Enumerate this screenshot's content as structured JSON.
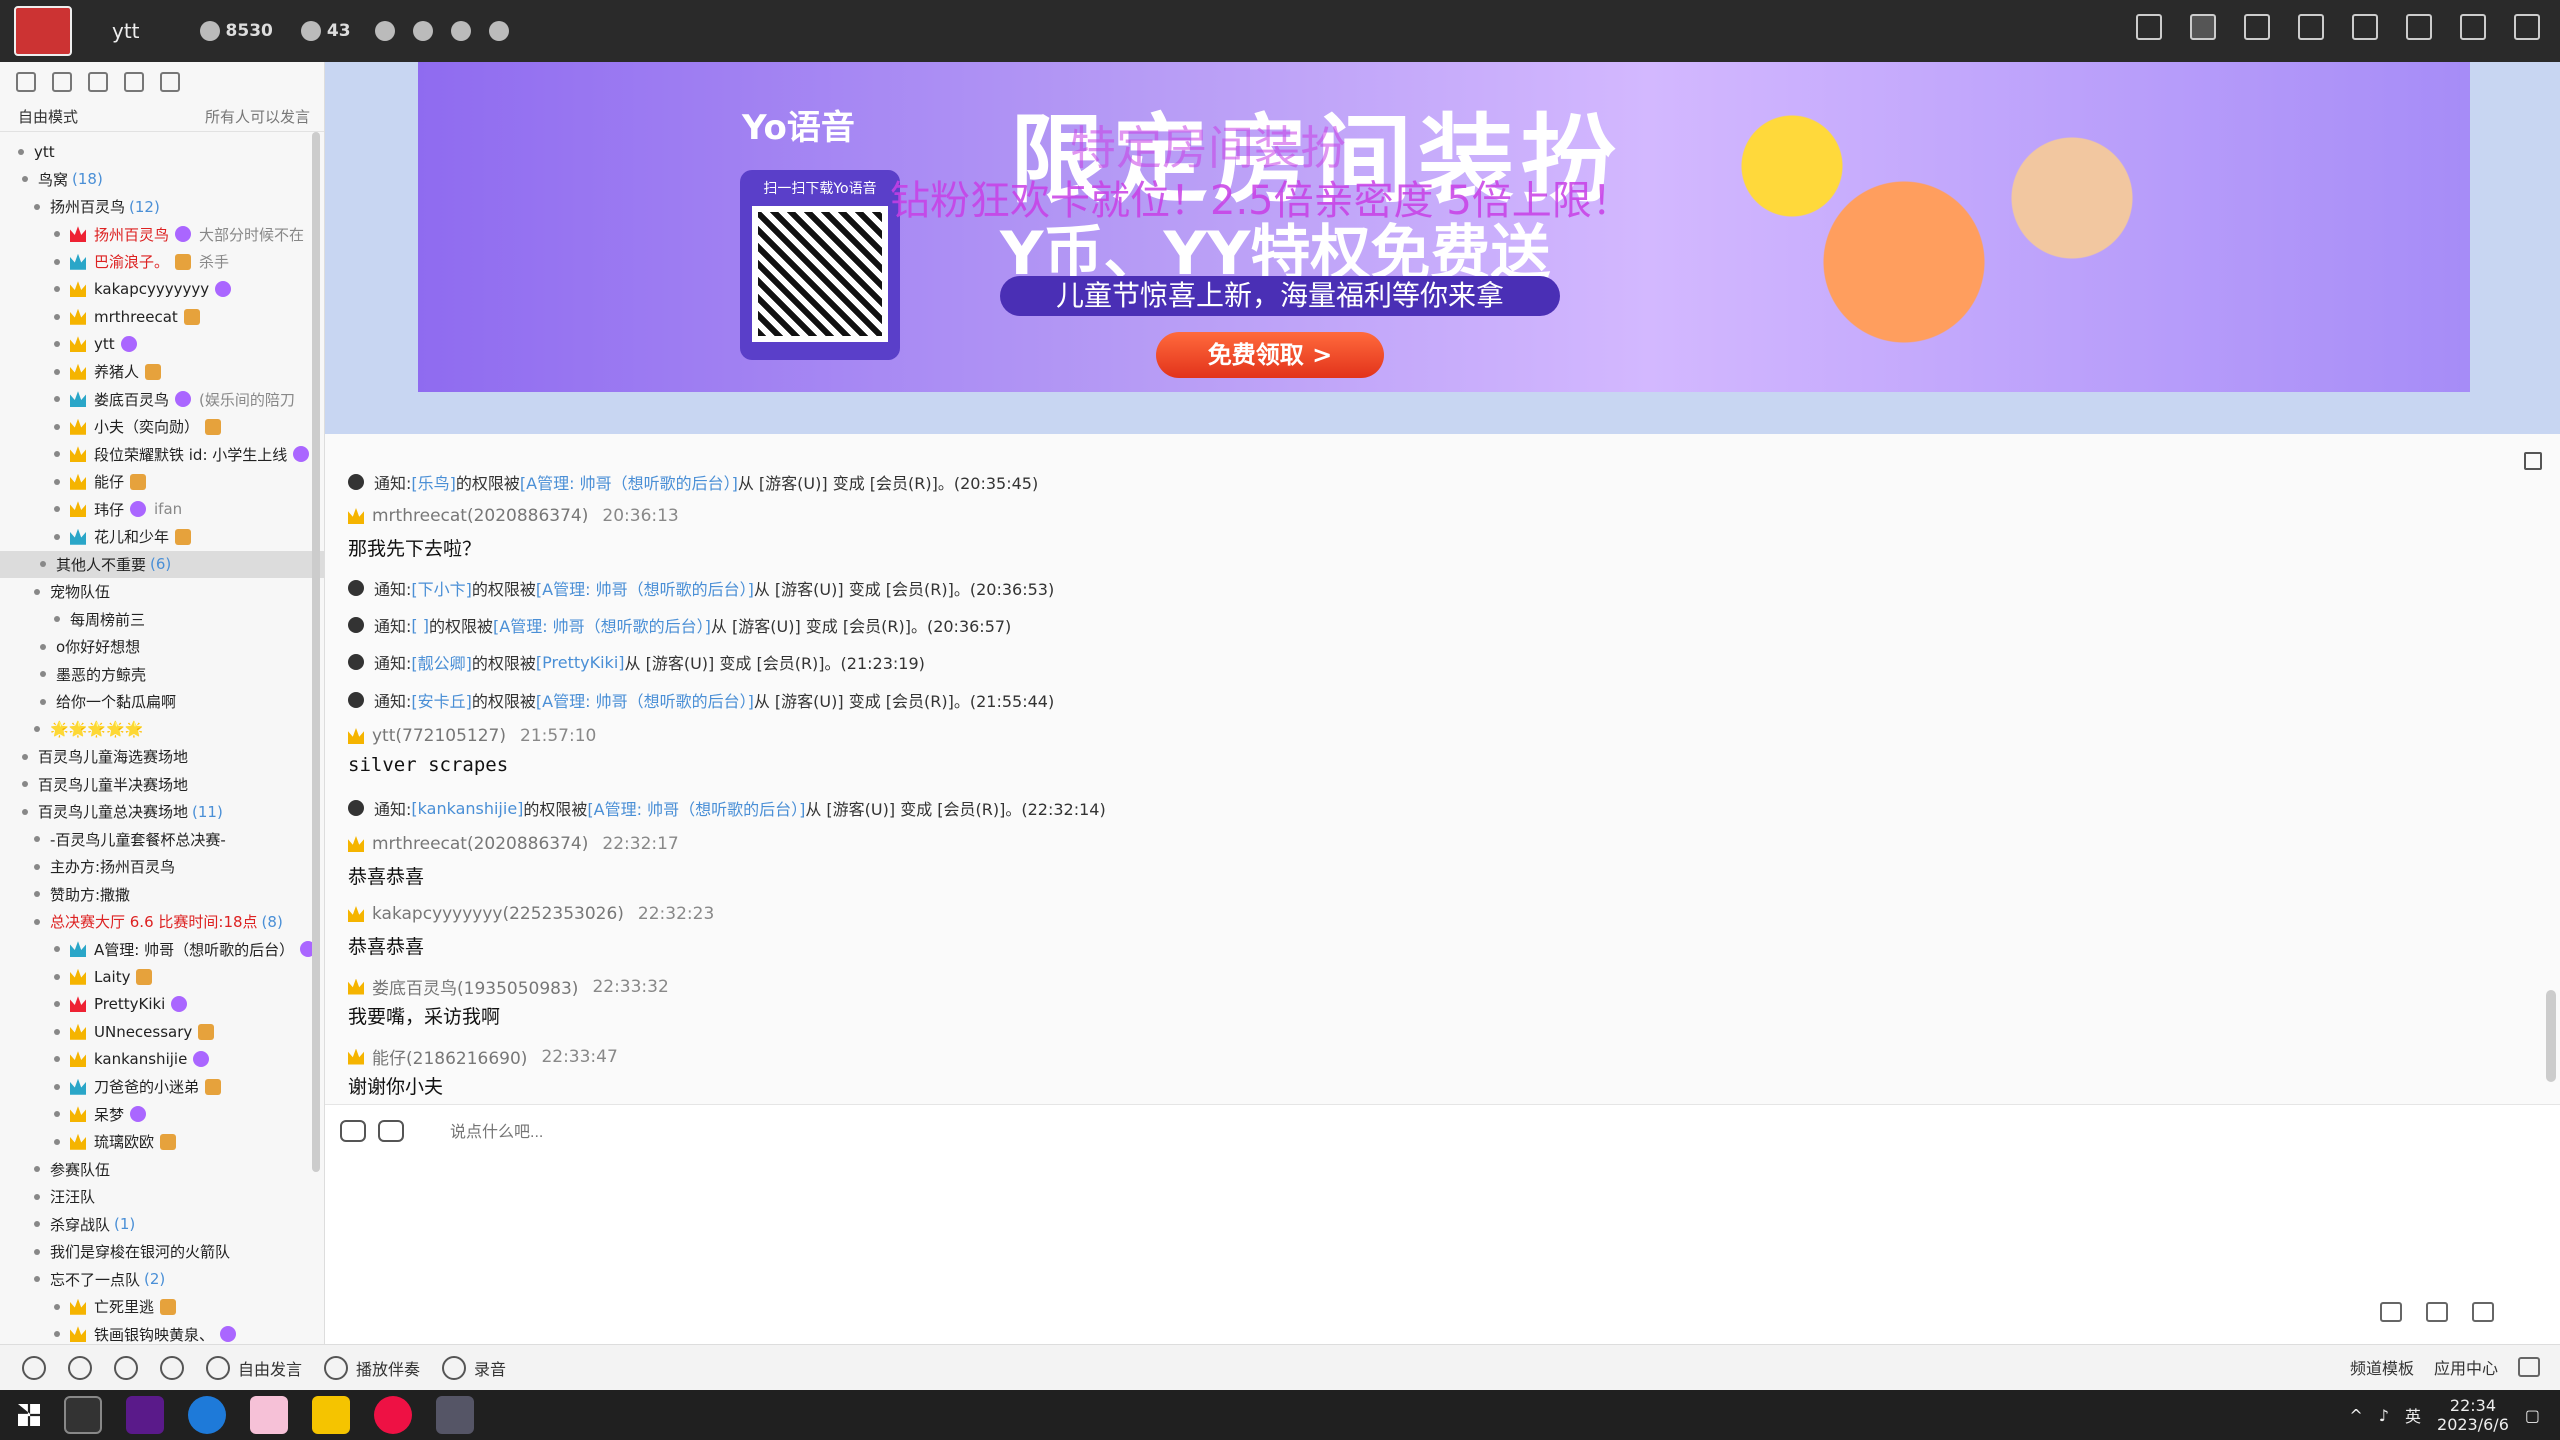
{
  "topbar": {
    "username": "ytt",
    "stat1": "8530",
    "stat2": "43"
  },
  "left": {
    "mode_label": "自由模式",
    "mode_hint": "所有人可以发言",
    "rows": [
      {
        "t": "ytt"
      },
      {
        "t": "鸟窝",
        "c": "(18)"
      },
      {
        "t": "扬州百灵鸟",
        "c": "(12)"
      },
      {
        "t": "扬州百灵鸟",
        "g": "大部分时候不在"
      },
      {
        "t": "巴渝浪子。",
        "g": "杀手"
      },
      {
        "t": "kakapcyyyyyyy"
      },
      {
        "t": "mrthreecat"
      },
      {
        "t": "ytt"
      },
      {
        "t": "养猪人"
      },
      {
        "t": "娄底百灵鸟",
        "g": "(娱乐间的陪刀"
      },
      {
        "t": "小夫（奕向勋）"
      },
      {
        "t": "段位荣耀默铁 id: 小学生上线"
      },
      {
        "t": "能仔"
      },
      {
        "t": "玮仔",
        "g": "ifan"
      },
      {
        "t": "花儿和少年"
      },
      {
        "t": "其他人不重要",
        "c": "(6)"
      },
      {
        "t": "宠物队伍"
      },
      {
        "t": "每周榜前三"
      },
      {
        "t": "o你好好想想"
      },
      {
        "t": "墨恶的方鲸壳"
      },
      {
        "t": "给你一个黏瓜扁啊"
      },
      {
        "t": "🌟🌟🌟🌟🌟"
      },
      {
        "t": "百灵鸟儿童海选赛场地"
      },
      {
        "t": "百灵鸟儿童半决赛场地"
      },
      {
        "t": "百灵鸟儿童总决赛场地",
        "c": "(11)"
      },
      {
        "t": "-百灵鸟儿童套餐杯总决赛-"
      },
      {
        "t": "主办方:扬州百灵鸟"
      },
      {
        "t": "赞助方:撒撒"
      },
      {
        "t": "总决赛大厅 6.6  比赛时间:18点",
        "c": "(8)"
      },
      {
        "t": "A管理: 帅哥（想听歌的后台）"
      },
      {
        "t": "Laity"
      },
      {
        "t": "PrettyKiki"
      },
      {
        "t": "UNnecessary"
      },
      {
        "t": "kankanshijie"
      },
      {
        "t": "刀爸爸的小迷弟"
      },
      {
        "t": "呆梦"
      },
      {
        "t": "琉璃欧欧"
      },
      {
        "t": "参赛队伍"
      },
      {
        "t": "汪汪队"
      },
      {
        "t": "杀穿战队",
        "c": "(1)"
      },
      {
        "t": "我们是穿梭在银河的火箭队"
      },
      {
        "t": "忘不了一点队",
        "c": "(2)"
      },
      {
        "t": "亡死里逃"
      },
      {
        "t": "铁画银钩映黄泉、"
      }
    ]
  },
  "banner": {
    "logo": "Yo语音",
    "qr_caption": "扫一扫下载Yo语音",
    "title": "限定房间装扮",
    "subtitle": "Y币、YY特权免费送",
    "strip": "儿童节惊喜上新，海量福利等你来拿",
    "button": "免费领取 >",
    "overlay": "钻粉狂欢卡就位！2.5倍亲密度 5倍上限！",
    "overlay2": "特定房间装扮"
  },
  "chat": [
    {
      "kind": "notice",
      "pre": "通知: ",
      "who": "[乐鸟]",
      "mid": " 的权限被 ",
      "by": "[A管理: 帅哥（想听歌的后台）]",
      "post": " 从 [游客(U)] 变成 [会员(R)]。(20:35:45)"
    },
    {
      "kind": "sender",
      "name": "mrthreecat(2020886374)",
      "time": "20:36:13"
    },
    {
      "kind": "body",
      "text": "那我先下去啦？"
    },
    {
      "kind": "notice",
      "pre": "通知: ",
      "who": "[下小卞]",
      "mid": " 的权限被 ",
      "by": "[A管理: 帅哥（想听歌的后台）]",
      "post": " 从 [游客(U)] 变成 [会员(R)]。(20:36:53)"
    },
    {
      "kind": "notice",
      "pre": "通知: ",
      "who": "[ ]",
      "mid": " 的权限被 ",
      "by": "[A管理: 帅哥（想听歌的后台）]",
      "post": " 从 [游客(U)] 变成 [会员(R)]。(20:36:57)"
    },
    {
      "kind": "notice",
      "pre": "通知: ",
      "who": "[靓公卿]",
      "mid": " 的权限被 ",
      "by": "[PrettyKiki]",
      "post": " 从 [游客(U)] 变成 [会员(R)]。(21:23:19)"
    },
    {
      "kind": "notice",
      "pre": "通知: ",
      "who": "[安卡丘]",
      "mid": " 的权限被 ",
      "by": "[A管理: 帅哥（想听歌的后台）]",
      "post": " 从 [游客(U)] 变成 [会员(R)]。(21:55:44)"
    },
    {
      "kind": "sender",
      "name": "ytt(772105127)",
      "time": "21:57:10"
    },
    {
      "kind": "body",
      "text": "silver scrapes",
      "mono": true
    },
    {
      "kind": "notice",
      "pre": "通知: ",
      "who": "[kankanshijie]",
      "mid": " 的权限被 ",
      "by": "[A管理: 帅哥（想听歌的后台）]",
      "post": " 从 [游客(U)] 变成 [会员(R)]。(22:32:14)"
    },
    {
      "kind": "sender",
      "name": "mrthreecat(2020886374)",
      "time": "22:32:17"
    },
    {
      "kind": "body",
      "text": "恭喜恭喜"
    },
    {
      "kind": "sender",
      "name": "kakapcyyyyyyy(2252353026)",
      "time": "22:32:23"
    },
    {
      "kind": "body",
      "text": "恭喜恭喜"
    },
    {
      "kind": "sender",
      "name": "娄底百灵鸟(1935050983)",
      "time": "22:33:32"
    },
    {
      "kind": "body",
      "text": "我要嘴，采访我啊"
    },
    {
      "kind": "sender",
      "name": "能仔(2186216690)",
      "time": "22:33:47"
    },
    {
      "kind": "body",
      "text": "谢谢你小夫"
    }
  ],
  "input": {
    "placeholder": "说点什么吧..."
  },
  "bottom": {
    "free_speak": "自由发言",
    "accompany": "播放伴奏",
    "record": "录音",
    "template": "频道模板",
    "app_center": "应用中心"
  },
  "taskbar": {
    "ime": "英",
    "time": "22:34",
    "date": "2023/6/6"
  }
}
